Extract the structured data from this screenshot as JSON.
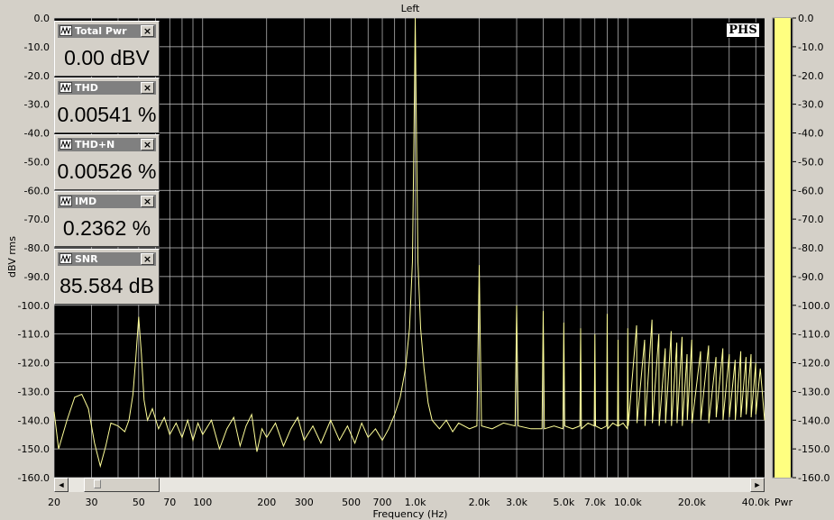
{
  "chart_data": {
    "type": "line",
    "title": "Left",
    "xlabel": "Frequency (Hz)",
    "ylabel": "dBV rms",
    "xscale": "log",
    "xlim": [
      20,
      44000
    ],
    "ylim": [
      -160,
      0
    ],
    "grid": true,
    "x_tick_labels": [
      {
        "v": 20,
        "label": "20"
      },
      {
        "v": 30,
        "label": "30"
      },
      {
        "v": 50,
        "label": "50"
      },
      {
        "v": 70,
        "label": "70"
      },
      {
        "v": 100,
        "label": "100"
      },
      {
        "v": 200,
        "label": "200"
      },
      {
        "v": 300,
        "label": "300"
      },
      {
        "v": 500,
        "label": "500"
      },
      {
        "v": 700,
        "label": "700"
      },
      {
        "v": 1000,
        "label": "1.0k"
      },
      {
        "v": 2000,
        "label": "2.0k"
      },
      {
        "v": 3000,
        "label": "3.0k"
      },
      {
        "v": 5000,
        "label": "5.0k"
      },
      {
        "v": 7000,
        "label": "7.0k"
      },
      {
        "v": 10000,
        "label": "10.0k"
      },
      {
        "v": 20000,
        "label": "20.0k"
      },
      {
        "v": 40000,
        "label": "40.0k"
      }
    ],
    "y_ticks": [
      0,
      -10,
      -20,
      -30,
      -40,
      -50,
      -60,
      -70,
      -80,
      -90,
      -100,
      -110,
      -120,
      -130,
      -140,
      -150,
      -160
    ],
    "y_tick_labels": [
      "0.0",
      "-10.0",
      "-20.0",
      "-30.0",
      "-40.0",
      "-50.0",
      "-60.0",
      "-70.0",
      "-80.0",
      "-90.0",
      "-100.0",
      "-110.0",
      "-120.0",
      "-130.0",
      "-140.0",
      "-150.0",
      "-160.0"
    ],
    "background": "#000000",
    "trace_color": "#ffff99",
    "grid_color": "#c8c8c8",
    "series": [
      {
        "points": [
          [
            20,
            -137
          ],
          [
            21,
            -150
          ],
          [
            23,
            -140
          ],
          [
            25,
            -132
          ],
          [
            27,
            -131
          ],
          [
            29,
            -136
          ],
          [
            31,
            -148
          ],
          [
            33,
            -156
          ],
          [
            35,
            -149
          ],
          [
            37,
            -141
          ],
          [
            40,
            -142
          ],
          [
            43,
            -144
          ],
          [
            45,
            -140
          ],
          [
            47,
            -131
          ],
          [
            48.5,
            -118
          ],
          [
            50,
            -104
          ],
          [
            51.5,
            -117
          ],
          [
            53,
            -133
          ],
          [
            55,
            -140
          ],
          [
            58,
            -136
          ],
          [
            62,
            -143
          ],
          [
            66,
            -139
          ],
          [
            70,
            -145
          ],
          [
            75,
            -141
          ],
          [
            80,
            -146
          ],
          [
            85,
            -140
          ],
          [
            90,
            -147
          ],
          [
            95,
            -141
          ],
          [
            100,
            -145
          ],
          [
            110,
            -140
          ],
          [
            120,
            -150
          ],
          [
            130,
            -143
          ],
          [
            140,
            -139
          ],
          [
            150,
            -149
          ],
          [
            160,
            -142
          ],
          [
            170,
            -138
          ],
          [
            180,
            -151
          ],
          [
            190,
            -143
          ],
          [
            200,
            -146
          ],
          [
            220,
            -141
          ],
          [
            240,
            -149
          ],
          [
            260,
            -143
          ],
          [
            280,
            -139
          ],
          [
            300,
            -147
          ],
          [
            330,
            -142
          ],
          [
            360,
            -148
          ],
          [
            400,
            -140
          ],
          [
            440,
            -147
          ],
          [
            480,
            -142
          ],
          [
            520,
            -148
          ],
          [
            560,
            -141
          ],
          [
            600,
            -146
          ],
          [
            650,
            -143
          ],
          [
            700,
            -147
          ],
          [
            750,
            -143
          ],
          [
            800,
            -138
          ],
          [
            850,
            -132
          ],
          [
            900,
            -122
          ],
          [
            940,
            -108
          ],
          [
            970,
            -85
          ],
          [
            985,
            -45
          ],
          [
            1000,
            0
          ],
          [
            1015,
            -45
          ],
          [
            1030,
            -85
          ],
          [
            1060,
            -108
          ],
          [
            1100,
            -122
          ],
          [
            1150,
            -134
          ],
          [
            1200,
            -140
          ],
          [
            1300,
            -143
          ],
          [
            1400,
            -140
          ],
          [
            1500,
            -144
          ],
          [
            1600,
            -141
          ],
          [
            1800,
            -143
          ],
          [
            1950,
            -142
          ],
          [
            2000,
            -86
          ],
          [
            2050,
            -142
          ],
          [
            2300,
            -143
          ],
          [
            2600,
            -141
          ],
          [
            2950,
            -142
          ],
          [
            3000,
            -100
          ],
          [
            3050,
            -142
          ],
          [
            3500,
            -143
          ],
          [
            3950,
            -143
          ],
          [
            4000,
            -102
          ],
          [
            4050,
            -143
          ],
          [
            4500,
            -142
          ],
          [
            4950,
            -143
          ],
          [
            5000,
            -106
          ],
          [
            5050,
            -142
          ],
          [
            5500,
            -143
          ],
          [
            5950,
            -142
          ],
          [
            6000,
            -108
          ],
          [
            6050,
            -143
          ],
          [
            6500,
            -141
          ],
          [
            6950,
            -142
          ],
          [
            7000,
            -110
          ],
          [
            7050,
            -142
          ],
          [
            7500,
            -143
          ],
          [
            7950,
            -142
          ],
          [
            8000,
            -103
          ],
          [
            8050,
            -143
          ],
          [
            8500,
            -141
          ],
          [
            8950,
            -142
          ],
          [
            9000,
            -112
          ],
          [
            9050,
            -142
          ],
          [
            9500,
            -141
          ],
          [
            9950,
            -143
          ],
          [
            10000,
            -108
          ],
          [
            10050,
            -142
          ],
          [
            11000,
            -107
          ],
          [
            11050,
            -141
          ],
          [
            12000,
            -112
          ],
          [
            12050,
            -142
          ],
          [
            13000,
            -105
          ],
          [
            13050,
            -141
          ],
          [
            14000,
            -110
          ],
          [
            14050,
            -142
          ],
          [
            15000,
            -115
          ],
          [
            15050,
            -141
          ],
          [
            16000,
            -109
          ],
          [
            16050,
            -142
          ],
          [
            17000,
            -113
          ],
          [
            17050,
            -141
          ],
          [
            18000,
            -111
          ],
          [
            18050,
            -142
          ],
          [
            19000,
            -117
          ],
          [
            19050,
            -140
          ],
          [
            20000,
            -112
          ],
          [
            20050,
            -141
          ],
          [
            22000,
            -116
          ],
          [
            22050,
            -140
          ],
          [
            24000,
            -114
          ],
          [
            24050,
            -141
          ],
          [
            26000,
            -118
          ],
          [
            26050,
            -139
          ],
          [
            28000,
            -115
          ],
          [
            28050,
            -140
          ],
          [
            30000,
            -117
          ],
          [
            30050,
            -139
          ],
          [
            32000,
            -119
          ],
          [
            32050,
            -140
          ],
          [
            34000,
            -116
          ],
          [
            34050,
            -139
          ],
          [
            36000,
            -118
          ],
          [
            36050,
            -138
          ],
          [
            38000,
            -117
          ],
          [
            38050,
            -139
          ],
          [
            40000,
            -120
          ],
          [
            40050,
            -138
          ],
          [
            42000,
            -122
          ],
          [
            44000,
            -140
          ]
        ]
      }
    ],
    "meter": {
      "label": "Pwr",
      "ticks": [
        "0.0",
        "-10.0",
        "-20.0",
        "-30.0",
        "-40.0",
        "-50.0",
        "-60.0",
        "-70.0",
        "-80.0",
        "-90.0",
        "-100.0",
        "-110.0",
        "-120.0",
        "-130.0",
        "-140.0",
        "-150.0",
        "-160.0"
      ],
      "range": [
        -160,
        0
      ],
      "level": 0,
      "fill_color": "#ffff80"
    }
  },
  "readouts": [
    {
      "title": "Total Pwr",
      "value": "0.00 dBV rms"
    },
    {
      "title": "THD",
      "value": "0.00541 %"
    },
    {
      "title": "THD+N",
      "value": "0.00526 %"
    },
    {
      "title": "IMD",
      "value": "0.2362 %"
    },
    {
      "title": "SNR",
      "value": "85.584 dB"
    }
  ],
  "logo": "PHS",
  "scrollbar": {
    "left_arrow": "◄",
    "right_arrow": "►"
  }
}
